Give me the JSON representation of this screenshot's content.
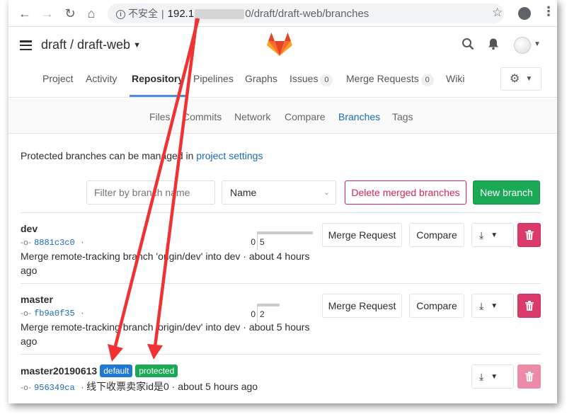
{
  "browser": {
    "back_icon": "arrow-left",
    "forward_icon": "arrow-right",
    "reload_icon": "reload",
    "home_icon": "home",
    "security_text": "不安全",
    "url_host": "192.1",
    "url_path": "0/draft/draft-web/branches",
    "star_icon": "star"
  },
  "header": {
    "project_title": "draft / draft-web",
    "search_icon": "search",
    "bell_icon": "bell"
  },
  "tabs": [
    {
      "label": "Project"
    },
    {
      "label": "Activity"
    },
    {
      "label": "Repository"
    },
    {
      "label": "Pipelines"
    },
    {
      "label": "Graphs"
    },
    {
      "label": "Issues",
      "count": "0"
    },
    {
      "label": "Merge Requests",
      "count": "0"
    },
    {
      "label": "Wiki"
    }
  ],
  "subtabs": [
    {
      "label": "Files"
    },
    {
      "label": "Commits"
    },
    {
      "label": "Network"
    },
    {
      "label": "Compare"
    },
    {
      "label": "Branches"
    },
    {
      "label": "Tags"
    }
  ],
  "notice": {
    "text": "Protected branches can be managed in ",
    "link": "project settings"
  },
  "controls": {
    "filter_placeholder": "Filter by branch name",
    "sort_value": "Name",
    "delete_merged": "Delete merged branches",
    "new_branch": "New branch"
  },
  "branches": [
    {
      "name": "dev",
      "sha": "8881c3c0",
      "message": "Merge remote-tracking branch 'origin/dev' into dev · about 4 hours ago",
      "behind": "0",
      "ahead": "5",
      "ahead_ratio": 1.0,
      "merge_request_label": "Merge Request",
      "compare_label": "Compare"
    },
    {
      "name": "master",
      "sha": "fb9a0f35",
      "message": "Merge remote-tracking branch 'origin/dev' into dev · about 5 hours ago",
      "behind": "0",
      "ahead": "2",
      "ahead_ratio": 0.4,
      "merge_request_label": "Merge Request",
      "compare_label": "Compare"
    },
    {
      "name": "master20190613",
      "badge_default": "default",
      "badge_protected": "protected",
      "sha": "956349ca",
      "message": "线下收票卖家id是0 · about 5 hours ago"
    }
  ],
  "colors": {
    "link": "#1b69b6",
    "success": "#1aaa55",
    "danger": "#db3b6a",
    "default_badge": "#1f78d1",
    "annotation_arrow": "#f03232"
  }
}
